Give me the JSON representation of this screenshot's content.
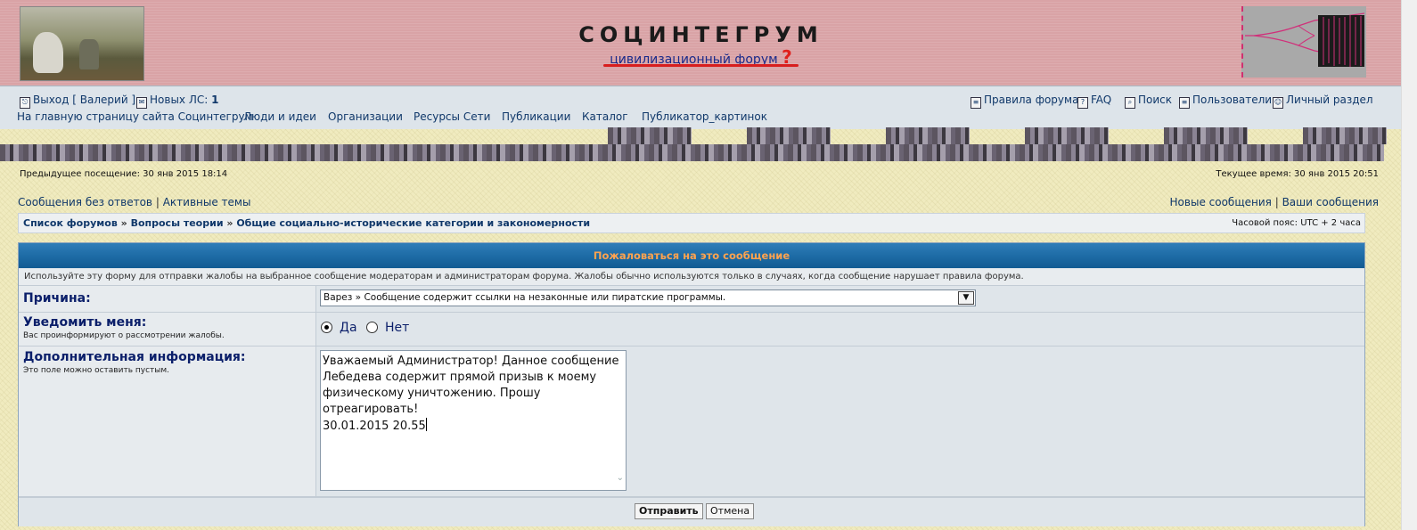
{
  "header": {
    "title": "СОЦИНТЕГРУМ",
    "subtitle": "цивилизационный форум",
    "subtitle_mark": "?",
    "colors": {
      "background": "#d9a3a6",
      "subtitle_underline": "#d81e1e"
    }
  },
  "nav_top": {
    "logout": "Выход [ Валерий ]",
    "new_pm_label": "Новых ЛС:",
    "new_pm_count": "1",
    "rules": "Правила форума",
    "faq": "FAQ",
    "search": "Поиск",
    "users": "Пользователи",
    "personal": "Личный раздел"
  },
  "nav_main": [
    "На главную страницу сайта Социнтегрум",
    "Люди и идеи",
    "Организации",
    "Ресурсы Сети",
    "Публикации",
    "Каталог",
    "Публикатор_картинок"
  ],
  "visit": {
    "previous": "Предыдущее посещение: 30 янв 2015 18:14",
    "current": "Текущее время: 30 янв 2015 20:51"
  },
  "links": {
    "unanswered": "Сообщения без ответов",
    "active": "Активные темы",
    "new_posts": "Новые сообщения",
    "your_posts": "Ваши сообщения",
    "separator": "|"
  },
  "breadcrumb": {
    "items": [
      "Список форумов",
      "Вопросы теории",
      "Общие социально-исторические категории и закономерности"
    ],
    "separator": "»",
    "timezone": "Часовой пояс: UTC + 2 часа"
  },
  "report_form": {
    "title": "Пожаловаться на это сообщение",
    "description": "Используйте эту форму для отправки жалобы на выбранное сообщение модераторам и администраторам форума. Жалобы обычно используются только в случаях, когда сообщение нарушает правила форума.",
    "reason_label": "Причина:",
    "reason_value": "Варез » Сообщение содержит ссылки на незаконные или пиратские программы.",
    "notify_label": "Уведомить меня:",
    "notify_hint": "Вас проинформируют о рассмотрении жалобы.",
    "notify_yes": "Да",
    "notify_no": "Нет",
    "notify_selected": "yes",
    "info_label": "Дополнительная информация:",
    "info_hint": "Это поле можно оставить пустым.",
    "info_value": "Уважаемый Администратор! Данное сообщение\nЛебедева содержит прямой призыв к моему\nфизическому уничтожению. Прошу\nотреагировать!\n30.01.2015 20.55",
    "submit": "Отправить",
    "cancel": "Отмена"
  }
}
